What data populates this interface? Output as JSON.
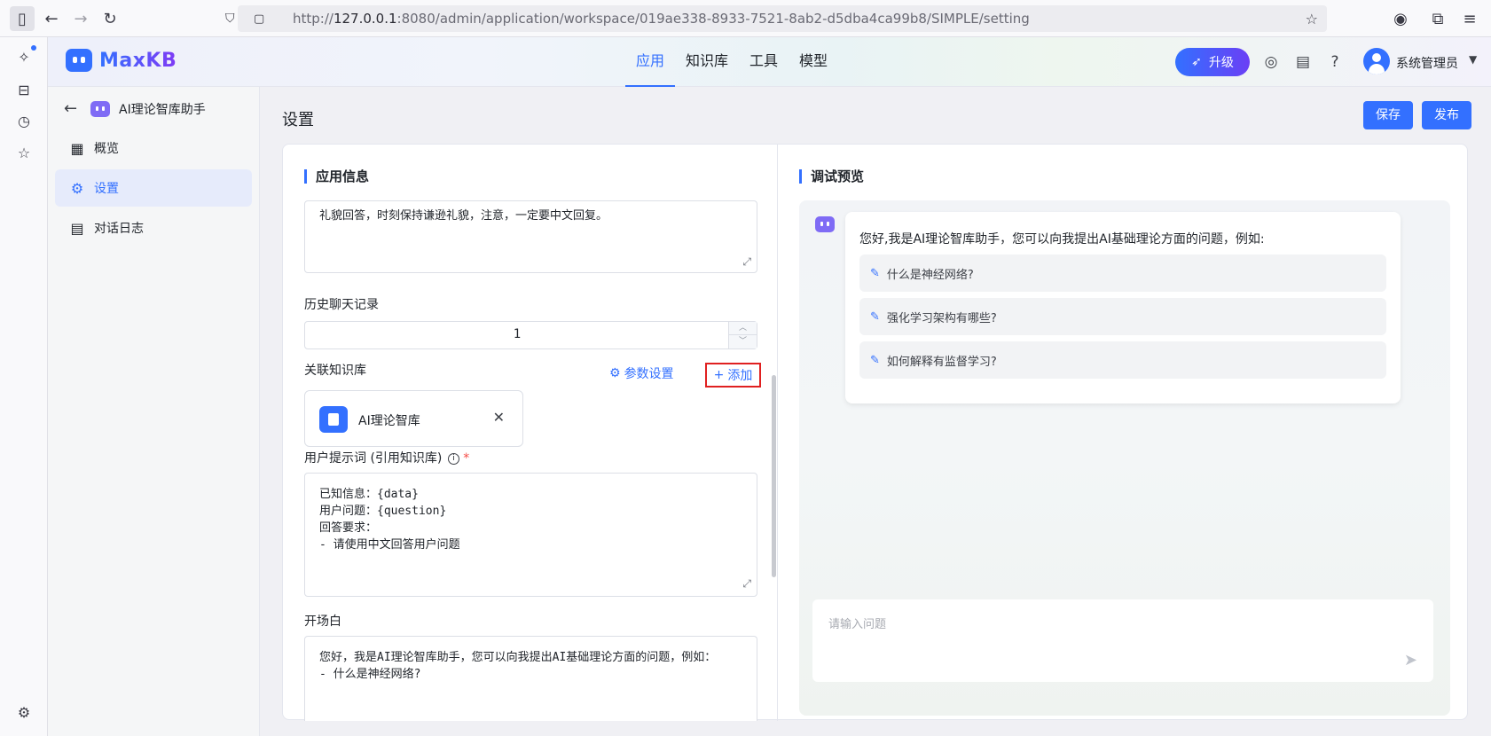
{
  "browser": {
    "url_prefix": "http://",
    "url_host": "127.0.0.1",
    "url_rest": ":8080/admin/application/workspace/019ae338-8933-7521-8ab2-d5dba4ca99b8/SIMPLE/setting"
  },
  "header": {
    "brand": "MaxKB",
    "nav": [
      "应用",
      "知识库",
      "工具",
      "模型"
    ],
    "upgrade": "升级",
    "user": "系统管理员"
  },
  "sidebar": {
    "app_name": "AI理论智库助手",
    "items": [
      "概览",
      "设置",
      "对话日志"
    ]
  },
  "main": {
    "title": "设置",
    "save": "保存",
    "publish": "发布"
  },
  "app_info": {
    "title": "应用信息",
    "system_prompt_tail": "礼貌回答，时刻保持谦逊礼貌，注意，一定要中文回复。",
    "history_label": "历史聊天记录",
    "history_value": "1",
    "kb_label": "关联知识库",
    "param_settings": "参数设置",
    "add": "添加",
    "kb_name": "AI理论智库",
    "user_prompt_label": "用户提示词 (引用知识库)",
    "user_prompt_lines": [
      "已知信息：{data}",
      "用户问题：{question}",
      "回答要求：",
      "- 请使用中文回答用户问题"
    ],
    "opening_label": "开场白",
    "opening_lines": [
      "您好，我是AI理论智库助手，您可以向我提出AI基础理论方面的问题，例如：",
      "- 什么是神经网络?"
    ]
  },
  "preview": {
    "title": "调试预览",
    "greeting": "您好,我是AI理论智库助手，您可以向我提出AI基础理论方面的问题，例如:",
    "suggestions": [
      "什么是神经网络?",
      "强化学习架构有哪些?",
      "如何解释有监督学习?"
    ],
    "input_placeholder": "请输入问题"
  }
}
